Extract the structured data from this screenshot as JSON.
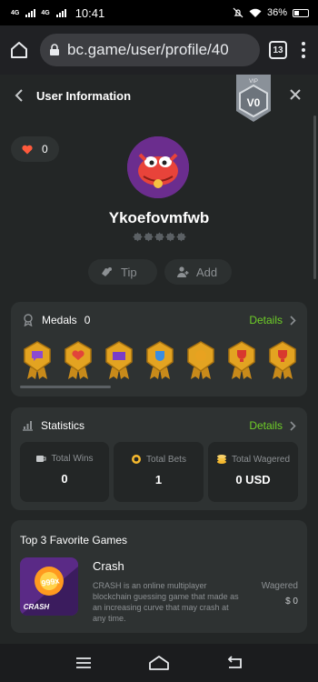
{
  "status_bar": {
    "network_1": "4G",
    "network_2": "4G",
    "time": "10:41",
    "battery": "36%"
  },
  "browser": {
    "url": "bc.game/user/profile/40",
    "tab_count": "13"
  },
  "header": {
    "title": "User Information",
    "vip_label": "VIP",
    "vip_level": "V0"
  },
  "profile": {
    "likes": "0",
    "username": "Ykoefovmfwb",
    "level_stars_filled": 0,
    "level_stars_total": 5
  },
  "actions": {
    "tip_label": "Tip",
    "add_label": "Add"
  },
  "medals": {
    "title": "Medals",
    "count": "0",
    "details_label": "Details",
    "icons": [
      "chat-bubble",
      "heart-ball",
      "card",
      "cup",
      "coin",
      "trophy",
      "trophy"
    ],
    "scroll_fraction": 0.3
  },
  "statistics": {
    "title": "Statistics",
    "details_label": "Details",
    "items": [
      {
        "label": "Total Wins",
        "value": "0",
        "icon": "trophy-icon"
      },
      {
        "label": "Total Bets",
        "value": "1",
        "icon": "chip-icon"
      },
      {
        "label": "Total Wagered",
        "value": "0 USD",
        "icon": "coins-icon"
      }
    ]
  },
  "favorite_games": {
    "title": "Top 3 Favorite Games",
    "games": [
      {
        "name": "Crash",
        "description": "CRASH is an online multiplayer blockchain guessing game that made as an increasing curve that may crash at any time.",
        "wagered_label": "Wagered",
        "wagered_value": "$ 0",
        "thumb_multiplier": "999x",
        "thumb_title": "CRASH"
      }
    ]
  },
  "colors": {
    "page_bg": "#232626",
    "card_bg": "#2e3232",
    "accent_green": "#6fcf28",
    "muted_text": "#8c9093",
    "heart": "#ff5a3c"
  }
}
